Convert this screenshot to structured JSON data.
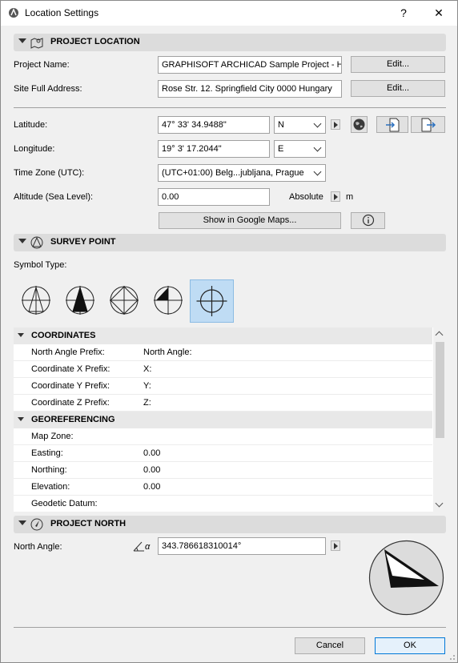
{
  "window": {
    "title": "Location Settings",
    "help_label": "?",
    "close_label": "✕"
  },
  "project_location": {
    "header": "PROJECT LOCATION",
    "project_name_label": "Project Name:",
    "project_name_value": "GRAPHISOFT ARCHICAD Sample Project - Hi",
    "site_address_label": "Site Full Address:",
    "site_address_value": "Rose Str. 12. Springfield City 0000 Hungary",
    "edit_label": "Edit...",
    "latitude_label": "Latitude:",
    "latitude_value": "47° 33' 34.9488\"",
    "latitude_hemisphere": "N",
    "longitude_label": "Longitude:",
    "longitude_value": "19° 3' 17.2044\"",
    "longitude_hemisphere": "E",
    "timezone_label": "Time Zone (UTC):",
    "timezone_value": "(UTC+01:00) Belg...jubljana, Prague",
    "altitude_label": "Altitude (Sea Level):",
    "altitude_value": "0.00",
    "altitude_ref": "Absolute",
    "altitude_unit": "m",
    "google_maps_label": "Show in Google Maps..."
  },
  "survey_point": {
    "header": "SURVEY POINT",
    "symbol_type_label": "Symbol Type:",
    "selected_symbol_index": 4,
    "symbols": [
      "survey-symbol-1-icon",
      "survey-symbol-2-icon",
      "survey-symbol-3-icon",
      "survey-symbol-4-icon",
      "survey-symbol-5-icon"
    ]
  },
  "properties": {
    "coordinates": {
      "header": "COORDINATES",
      "rows": [
        {
          "key": "North Angle Prefix:",
          "value": "North Angle:"
        },
        {
          "key": "Coordinate X Prefix:",
          "value": "X:"
        },
        {
          "key": "Coordinate Y Prefix:",
          "value": "Y:"
        },
        {
          "key": "Coordinate Z Prefix:",
          "value": "Z:"
        }
      ]
    },
    "georeferencing": {
      "header": "GEOREFERENCING",
      "rows": [
        {
          "key": "Map Zone:",
          "value": ""
        },
        {
          "key": "Easting:",
          "value": "0.00"
        },
        {
          "key": "Northing:",
          "value": "0.00"
        },
        {
          "key": "Elevation:",
          "value": "0.00"
        },
        {
          "key": "Geodetic Datum:",
          "value": ""
        }
      ]
    }
  },
  "project_north": {
    "header": "PROJECT NORTH",
    "north_angle_label": "North Angle:",
    "north_angle_value": "343.786618310014°",
    "angle_symbol": "α"
  },
  "footer": {
    "cancel_label": "Cancel",
    "ok_label": "OK"
  }
}
